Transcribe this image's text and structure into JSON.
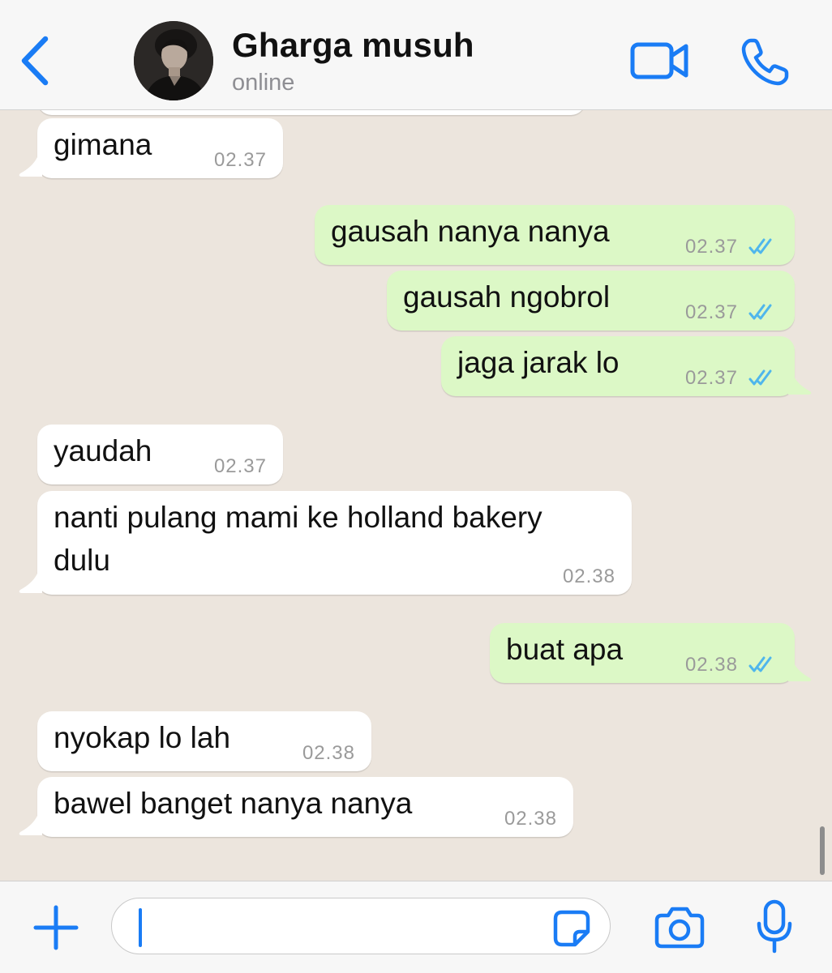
{
  "theme": {
    "accent": "#1a7cf5",
    "background": "#ece5dd",
    "incoming_bubble": "#ffffff",
    "outgoing_bubble": "#dcf8c6",
    "read_ticks": "#4fb6ec"
  },
  "header": {
    "back_icon": "chevron-left-icon",
    "contact_name": "Gharga musuh",
    "status": "online",
    "video_icon": "video-camera-icon",
    "call_icon": "phone-icon"
  },
  "messages": [
    {
      "direction": "in",
      "text": "gimana",
      "time": "02.37",
      "tail": true
    },
    {
      "direction": "out",
      "text": "gausah nanya nanya",
      "time": "02.37",
      "read": true,
      "tail": false
    },
    {
      "direction": "out",
      "text": "gausah ngobrol",
      "time": "02.37",
      "read": true,
      "tail": false
    },
    {
      "direction": "out",
      "text": "jaga jarak lo",
      "time": "02.37",
      "read": true,
      "tail": true
    },
    {
      "direction": "in",
      "text": "yaudah",
      "time": "02.37",
      "tail": false
    },
    {
      "direction": "in",
      "text": "nanti pulang mami ke holland bakery\ndulu",
      "time": "02.38",
      "tail": true
    },
    {
      "direction": "out",
      "text": "buat apa",
      "time": "02.38",
      "read": true,
      "tail": true
    },
    {
      "direction": "in",
      "text": "nyokap lo lah",
      "time": "02.38",
      "tail": false
    },
    {
      "direction": "in",
      "text": "bawel banget nanya nanya",
      "time": "02.38",
      "tail": true
    }
  ],
  "input_bar": {
    "plus_icon": "plus-icon",
    "message_value": "",
    "sticker_icon": "sticker-icon",
    "camera_icon": "camera-icon",
    "mic_icon": "microphone-icon"
  }
}
